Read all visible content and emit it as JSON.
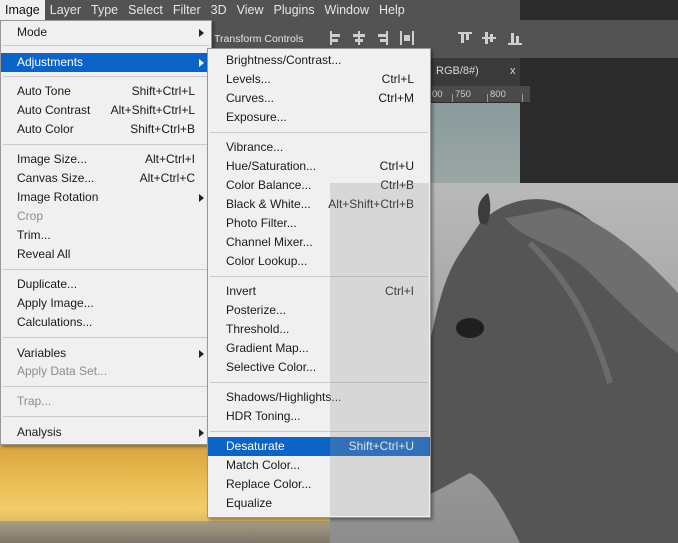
{
  "menubar": {
    "items": [
      "Image",
      "Layer",
      "Type",
      "Select",
      "Filter",
      "3D",
      "View",
      "Plugins",
      "Window",
      "Help"
    ],
    "active": "Image"
  },
  "options_bar": {
    "label": "Transform Controls"
  },
  "document": {
    "tab_label": "RGB/8#)",
    "tab_close": "x",
    "ruler_marks": [
      "00",
      "750",
      "800"
    ]
  },
  "image_menu": {
    "items": [
      {
        "label": "Mode",
        "shortcut": "",
        "submenu": true
      },
      {
        "label": "Adjustments",
        "shortcut": "",
        "submenu": true,
        "selected": true
      },
      {
        "label": "Auto Tone",
        "shortcut": "Shift+Ctrl+L"
      },
      {
        "label": "Auto Contrast",
        "shortcut": "Alt+Shift+Ctrl+L"
      },
      {
        "label": "Auto Color",
        "shortcut": "Shift+Ctrl+B"
      },
      {
        "label": "Image Size...",
        "shortcut": "Alt+Ctrl+I"
      },
      {
        "label": "Canvas Size...",
        "shortcut": "Alt+Ctrl+C"
      },
      {
        "label": "Image Rotation",
        "shortcut": "",
        "submenu": true
      },
      {
        "label": "Crop",
        "shortcut": "",
        "disabled": true
      },
      {
        "label": "Trim...",
        "shortcut": ""
      },
      {
        "label": "Reveal All",
        "shortcut": ""
      },
      {
        "label": "Duplicate...",
        "shortcut": ""
      },
      {
        "label": "Apply Image...",
        "shortcut": ""
      },
      {
        "label": "Calculations...",
        "shortcut": ""
      },
      {
        "label": "Variables",
        "shortcut": "",
        "submenu": true
      },
      {
        "label": "Apply Data Set...",
        "shortcut": "",
        "disabled": true
      },
      {
        "label": "Trap...",
        "shortcut": "",
        "disabled": true
      },
      {
        "label": "Analysis",
        "shortcut": "",
        "submenu": true
      }
    ]
  },
  "adjustments_menu": {
    "items": [
      {
        "label": "Brightness/Contrast...",
        "shortcut": ""
      },
      {
        "label": "Levels...",
        "shortcut": "Ctrl+L"
      },
      {
        "label": "Curves...",
        "shortcut": "Ctrl+M"
      },
      {
        "label": "Exposure...",
        "shortcut": ""
      },
      {
        "label": "Vibrance...",
        "shortcut": ""
      },
      {
        "label": "Hue/Saturation...",
        "shortcut": "Ctrl+U"
      },
      {
        "label": "Color Balance...",
        "shortcut": "Ctrl+B"
      },
      {
        "label": "Black & White...",
        "shortcut": "Alt+Shift+Ctrl+B"
      },
      {
        "label": "Photo Filter...",
        "shortcut": ""
      },
      {
        "label": "Channel Mixer...",
        "shortcut": ""
      },
      {
        "label": "Color Lookup...",
        "shortcut": ""
      },
      {
        "label": "Invert",
        "shortcut": "Ctrl+I"
      },
      {
        "label": "Posterize...",
        "shortcut": ""
      },
      {
        "label": "Threshold...",
        "shortcut": ""
      },
      {
        "label": "Gradient Map...",
        "shortcut": ""
      },
      {
        "label": "Selective Color...",
        "shortcut": ""
      },
      {
        "label": "Shadows/Highlights...",
        "shortcut": ""
      },
      {
        "label": "HDR Toning...",
        "shortcut": ""
      },
      {
        "label": "Desaturate",
        "shortcut": "Shift+Ctrl+U",
        "selected": true
      },
      {
        "label": "Match Color...",
        "shortcut": ""
      },
      {
        "label": "Replace Color...",
        "shortcut": ""
      },
      {
        "label": "Equalize",
        "shortcut": ""
      }
    ]
  },
  "colors": {
    "highlight": "#0a63c7",
    "menu_bg": "#f0f0f0",
    "app_chrome": "#535353"
  }
}
